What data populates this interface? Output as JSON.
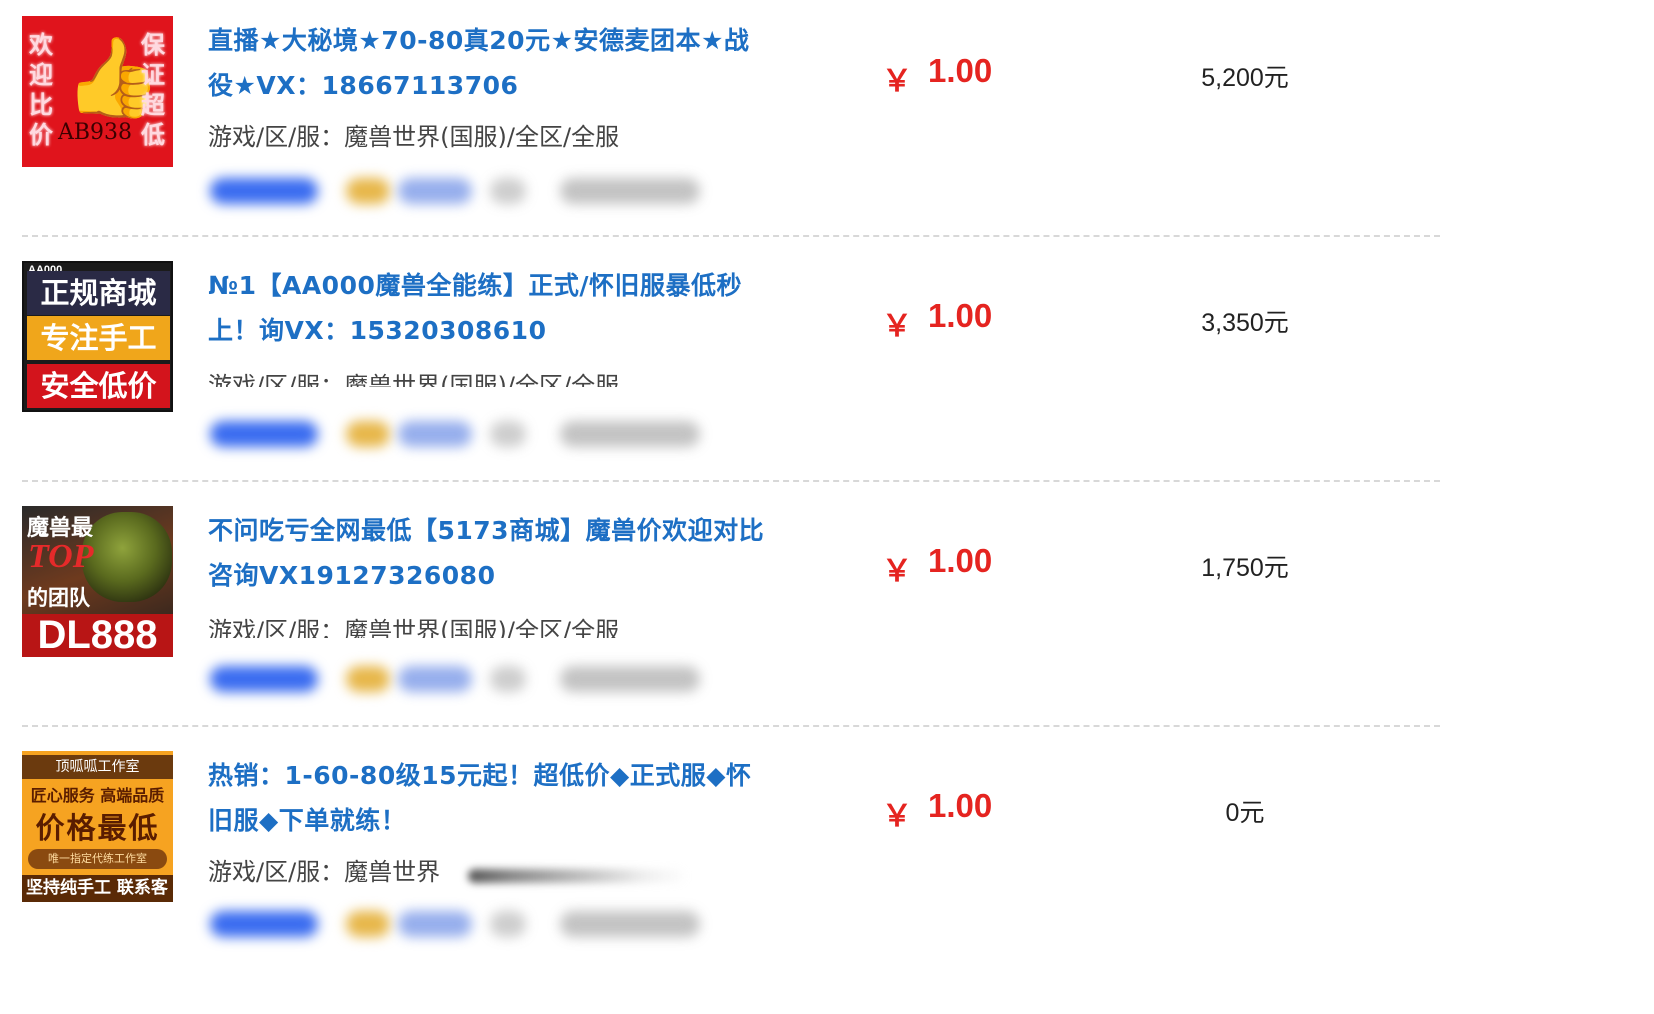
{
  "listings": [
    {
      "title": "直播★大秘境★70-80真20元★安德麦团本★战役★VX：18667113706",
      "meta": "游戏/区/服：魔兽世界(国服)/全区/全服",
      "currency": "￥",
      "price": "1.00",
      "stock": "5,200元",
      "thumb": {
        "left_col": "欢迎比价",
        "right_col": "保证超低",
        "code": "AB938"
      }
    },
    {
      "title": "№1【AA000魔兽全能练】正式/怀旧服暴低秒上！询VX：15320308610",
      "meta": "游戏/区/服：魔兽世界(国服)/全区/全服",
      "currency": "￥",
      "price": "1.00",
      "stock": "3,350元",
      "thumb": {
        "tag": "AA000",
        "line1": "正规商城",
        "line2": "专注手工",
        "line3": "安全低价"
      }
    },
    {
      "title": "不问吃亏全网最低【5173商城】魔兽价欢迎对比咨询VX19127326080",
      "meta": "游戏/区/服：魔兽世界(国服)/全区/全服",
      "currency": "￥",
      "price": "1.00",
      "stock": "1,750元",
      "thumb": {
        "line1": "魔兽最",
        "top": "TOP",
        "line2": "的团队",
        "code": "DL888"
      }
    },
    {
      "title": "热销：1-60-80级15元起！超低价◆正式服◆怀旧服◆下单就练！",
      "meta": "游戏/区/服：魔兽世界",
      "currency": "￥",
      "price": "1.00",
      "stock": "0元",
      "thumb": {
        "line1": "顶呱呱工作室",
        "line2": "匠心服务 高端品质",
        "line3": "价格最低",
        "line4": "唯一指定代练工作室",
        "line5": "坚持纯手工 联系客服"
      }
    }
  ]
}
